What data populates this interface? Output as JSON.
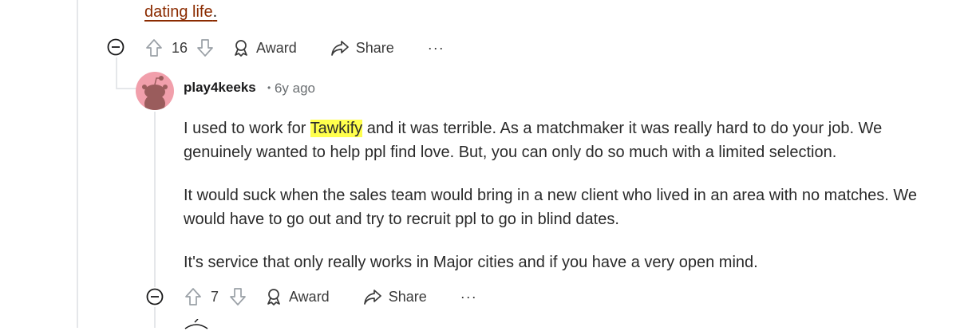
{
  "parent_comment": {
    "link_text": "dating life",
    "link_trailing": ".",
    "vote_count": "16",
    "award_label": "Award",
    "share_label": "Share",
    "more_label": "···"
  },
  "comment": {
    "author": "play4keeks",
    "time": "6y ago",
    "separator": "•",
    "paragraphs": [
      {
        "before": "I used to work for ",
        "highlight": "Tawkify",
        "after": " and it was terrible. As a matchmaker it was really hard to do your job. We genuinely wanted to help ppl find love. But, you can only do so much with a limited selection."
      },
      {
        "text": "It would suck when the sales team would bring in a new client who lived in an area with no matches. We would have to go out and try to recruit ppl to go in blind dates."
      },
      {
        "text": "It's service that only really works in Major cities and if you have a very open mind."
      }
    ],
    "vote_count": "7",
    "award_label": "Award",
    "share_label": "Share",
    "more_label": "···"
  },
  "colors": {
    "link": "#8b2b00",
    "highlight": "#ffff4d",
    "avatar_bg": "#f19fab",
    "thread_line": "#e5e7ea"
  }
}
